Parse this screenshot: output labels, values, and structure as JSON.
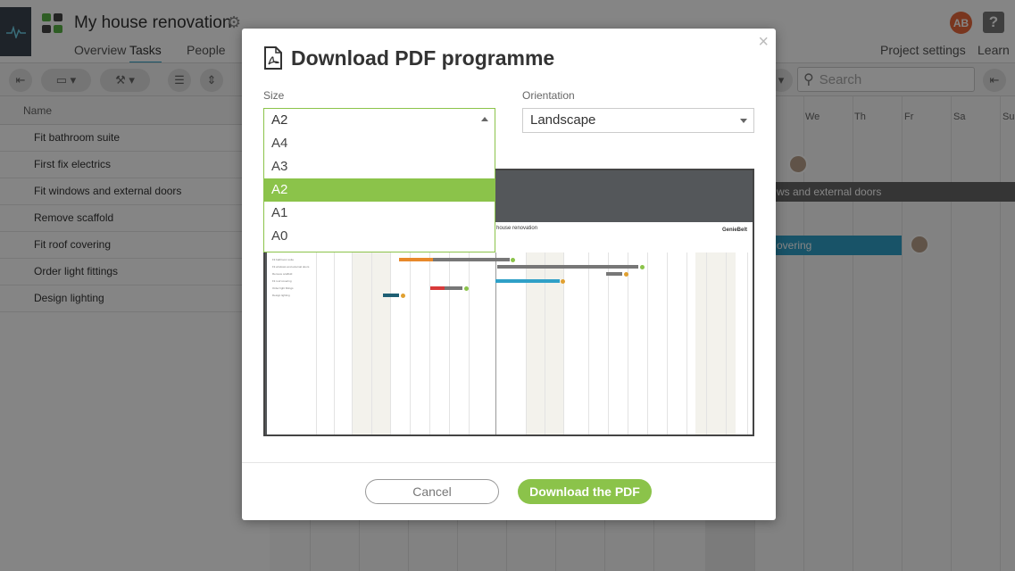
{
  "app": {
    "project_title": "My house renovation",
    "tabs": [
      "Overview",
      "Tasks",
      "People"
    ],
    "active_tab": "Tasks",
    "project_settings": "Project settings",
    "learn": "Learn",
    "user_initials": "AB",
    "help": "?",
    "search_placeholder": "Search",
    "name_column": "Name",
    "tasks": [
      "Fit bathroom suite",
      "First fix electrics",
      "Fit windows and external doors",
      "Remove scaffold",
      "Fit roof covering",
      "Order light fittings",
      "Design lighting"
    ],
    "days": [
      "We",
      "Th",
      "Fr",
      "Sa",
      "Su"
    ],
    "bar_labels": {
      "windows": "ws and external doors",
      "roof": "overing"
    }
  },
  "modal": {
    "title": "Download PDF programme",
    "size_label": "Size",
    "size_value": "A2",
    "size_options": [
      "A4",
      "A3",
      "A2",
      "A1",
      "A0"
    ],
    "orientation_label": "Orientation",
    "orientation_value": "Landscape",
    "preview": {
      "sheet_title": "house renovation",
      "brand": "GenieBelt"
    },
    "cancel_label": "Cancel",
    "download_label": "Download the PDF",
    "close_symbol": "×"
  },
  "colors": {
    "accent_green": "#8bc34a",
    "bar_grey": "#666666",
    "bar_teal": "#2fa0c7",
    "avatar_orange": "#e8683d"
  }
}
